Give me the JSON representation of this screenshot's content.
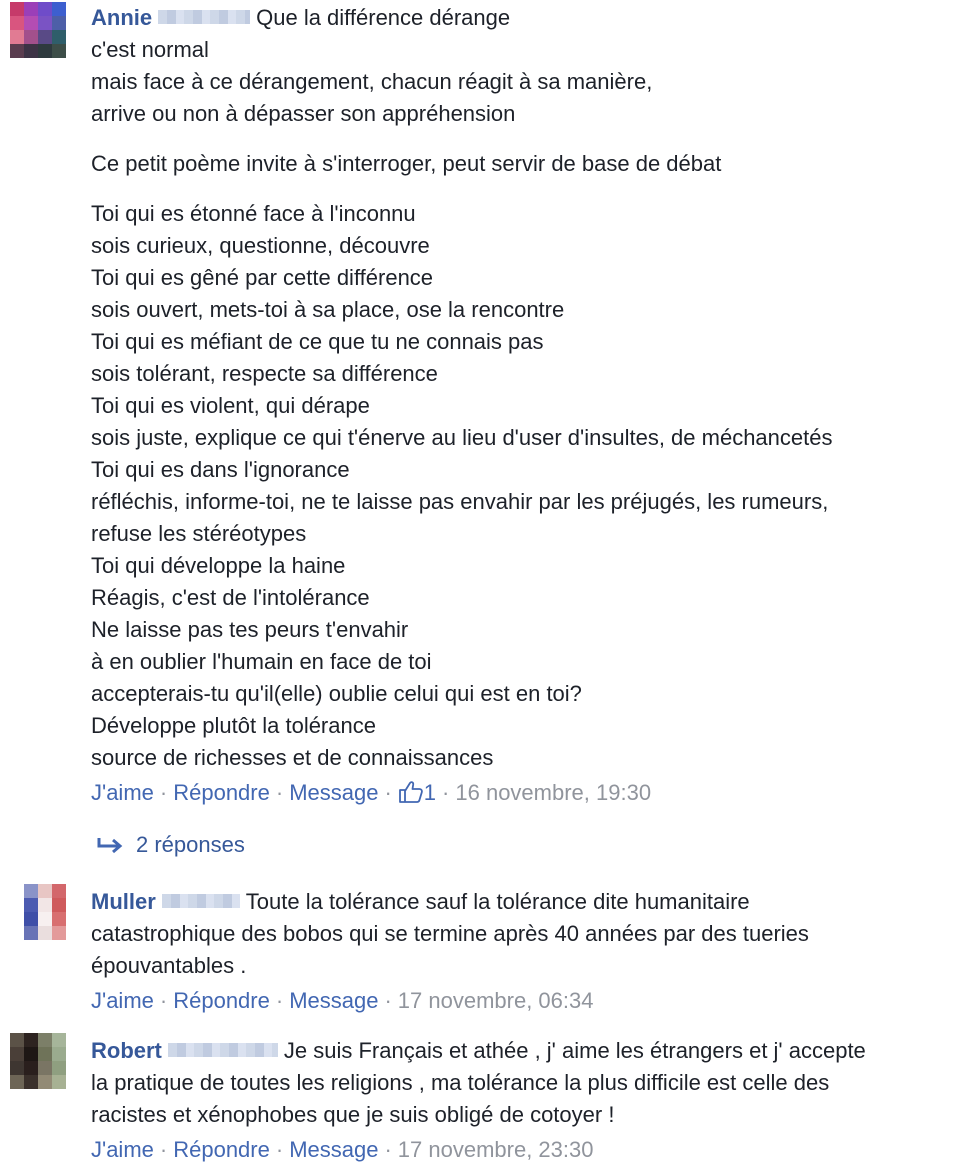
{
  "comments": [
    {
      "author": "Annie",
      "lines": [
        "Que la différence dérange",
        "c'est normal",
        "mais face à ce dérangement, chacun réagit à sa manière,",
        "arrive ou non à dépasser son appréhension",
        "",
        "Ce petit poème invite à s'interroger, peut servir de base de débat",
        "",
        "Toi qui es étonné face à l'inconnu",
        "sois curieux, questionne, découvre",
        "Toi qui es gêné par cette différence",
        "sois ouvert, mets-toi à sa place, ose la rencontre",
        "Toi qui es méfiant de ce que tu ne connais pas",
        "sois tolérant, respecte sa différence",
        "Toi qui es violent, qui dérape",
        "sois juste, explique ce qui t'énerve au lieu d'user d'insultes, de méchancetés",
        "Toi qui es dans l'ignorance",
        "réfléchis, informe-toi, ne te laisse pas envahir par les préjugés, les rumeurs,",
        "refuse les stéréotypes",
        "Toi qui développe la haine",
        "Réagis, c'est de l'intolérance",
        "Ne laisse pas tes peurs t'envahir",
        "à en oublier l'humain en face de toi",
        "accepterais-tu qu'il(elle) oublie celui qui est en toi?",
        "Développe plutôt la tolérance",
        "source de richesses et de connaissances"
      ],
      "like_label": "J'aime",
      "reply_label": "Répondre",
      "message_label": "Message",
      "like_count": "1",
      "timestamp": "16 novembre, 19:30"
    },
    {
      "author": "Muller",
      "lines": [
        "Toute la tolérance sauf la tolérance dite humanitaire",
        "catastrophique des bobos qui se termine après 40 années par des tueries",
        "épouvantables ."
      ],
      "like_label": "J'aime",
      "reply_label": "Répondre",
      "message_label": "Message",
      "timestamp": "17 novembre, 06:34"
    },
    {
      "author": "Robert",
      "lines": [
        "Je suis Français et athée , j' aime les étrangers et j' accepte",
        "la pratique de toutes les religions , ma tolérance la plus difficile est celle des",
        "racistes et xénophobes que je suis obligé de cotoyer !"
      ],
      "like_label": "J'aime",
      "reply_label": "Répondre",
      "message_label": "Message",
      "timestamp": "17 novembre, 23:30"
    }
  ],
  "replies_label": "2 réponses",
  "colors": {
    "link": "#4267b2",
    "author": "#365899",
    "meta": "#90949c",
    "text": "#1d2129"
  }
}
